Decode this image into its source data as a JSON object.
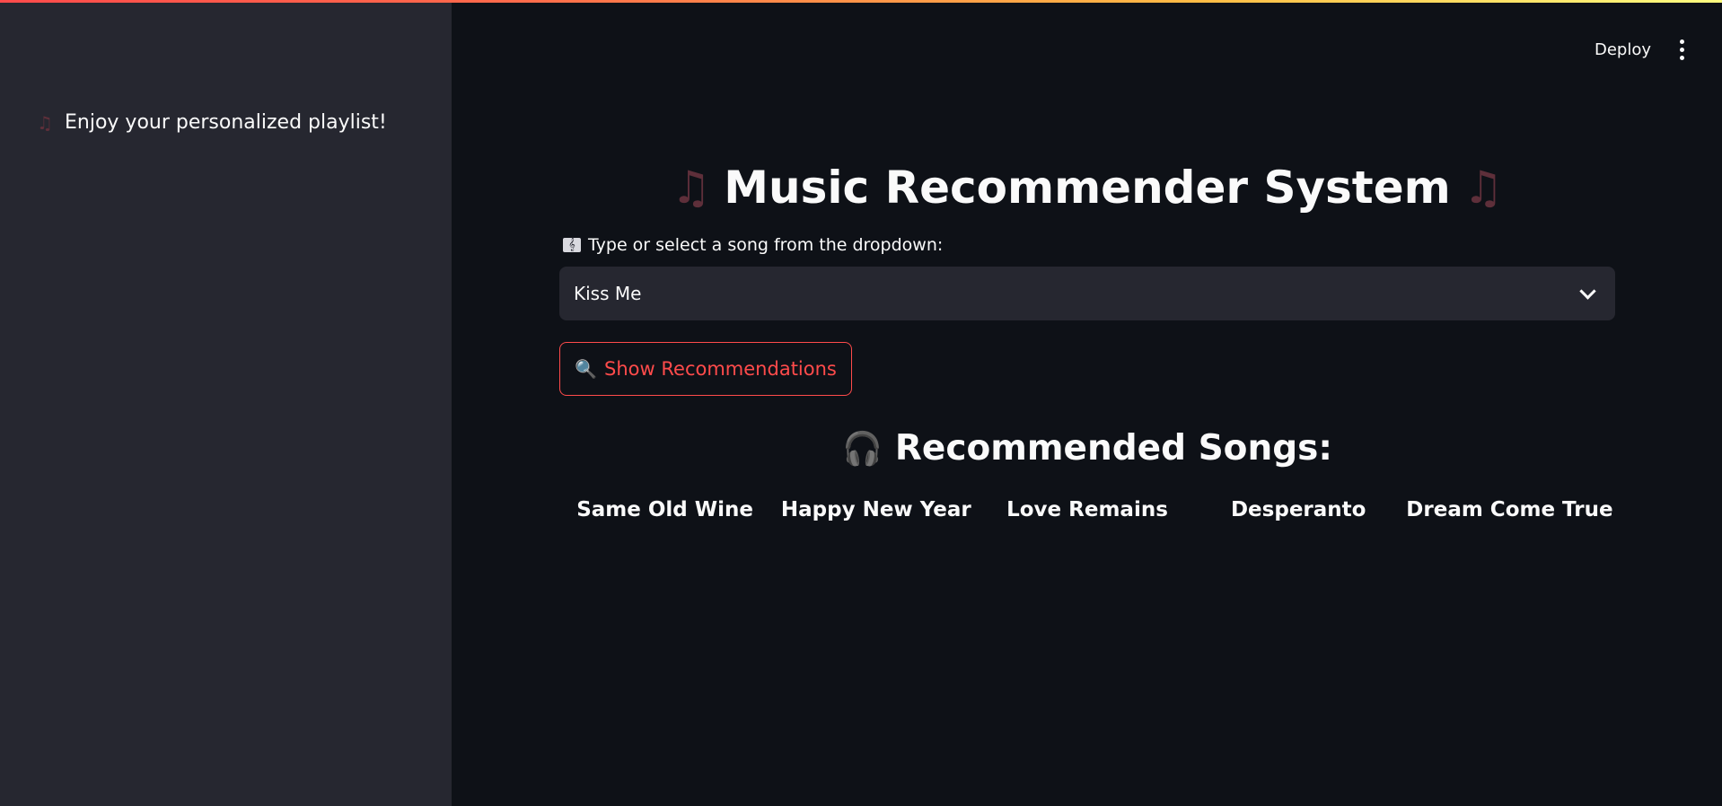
{
  "header": {
    "deploy_label": "Deploy",
    "menu_icon": "kebab-menu-icon"
  },
  "sidebar": {
    "icon": "musical-notes-icon",
    "message": "Enjoy your personalized playlist!"
  },
  "main": {
    "title": "Music Recommender System",
    "title_icon": "musical-notes-icon",
    "select_icon": "musical-score-icon",
    "select_label": "Type or select a song from the dropdown:",
    "selected_song": "Kiss Me",
    "button_icon": "magnifier-icon",
    "button_label": "Show Recommendations",
    "rec_icon": "headphones-icon",
    "rec_title": "Recommended Songs:",
    "recommendations": [
      "Same Old Wine",
      "Happy New Year",
      "Love Remains",
      "Desperanto",
      "Dream Come True"
    ]
  },
  "colors": {
    "accent": "#ff4b4b",
    "background": "#0e1117",
    "sidebar": "#262730",
    "text": "#fafafa"
  }
}
